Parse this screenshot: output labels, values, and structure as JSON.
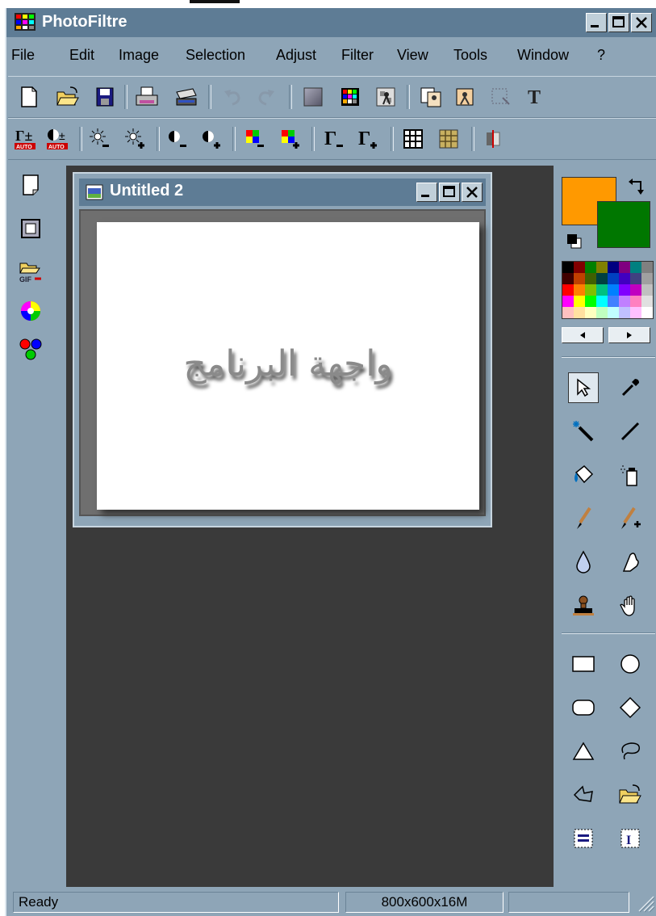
{
  "window": {
    "title": "PhotoFiltre",
    "icon": "photofiltre-icon"
  },
  "menu": [
    "File",
    "Edit",
    "Image",
    "Selection",
    "Adjust",
    "Filter",
    "View",
    "Tools",
    "Window",
    "?"
  ],
  "toolbar1": [
    "new-icon",
    "open-icon",
    "save-icon",
    "print-icon",
    "scan-icon",
    "undo-icon",
    "redo-icon",
    "gradient-icon",
    "palette-grid-icon",
    "transparent-icon",
    "copy-icon",
    "image-size-icon",
    "selection-icon",
    "text-icon"
  ],
  "toolbar2": [
    "auto-levels-icon",
    "auto-contrast-icon",
    "brightness-minus-icon",
    "brightness-plus-icon",
    "contrast-minus-icon",
    "contrast-plus-icon",
    "saturation-minus-icon",
    "saturation-plus-icon",
    "gamma-minus-icon",
    "gamma-plus-icon",
    "grid-icon",
    "texture-icon",
    "mirror-icon"
  ],
  "document": {
    "title": "Untitled 2",
    "content_text": "واجهة البرنامج"
  },
  "colors": {
    "foreground": "#ff9900",
    "background": "#007700"
  },
  "status": {
    "message": "Ready",
    "image_info": "800x600x16M"
  }
}
